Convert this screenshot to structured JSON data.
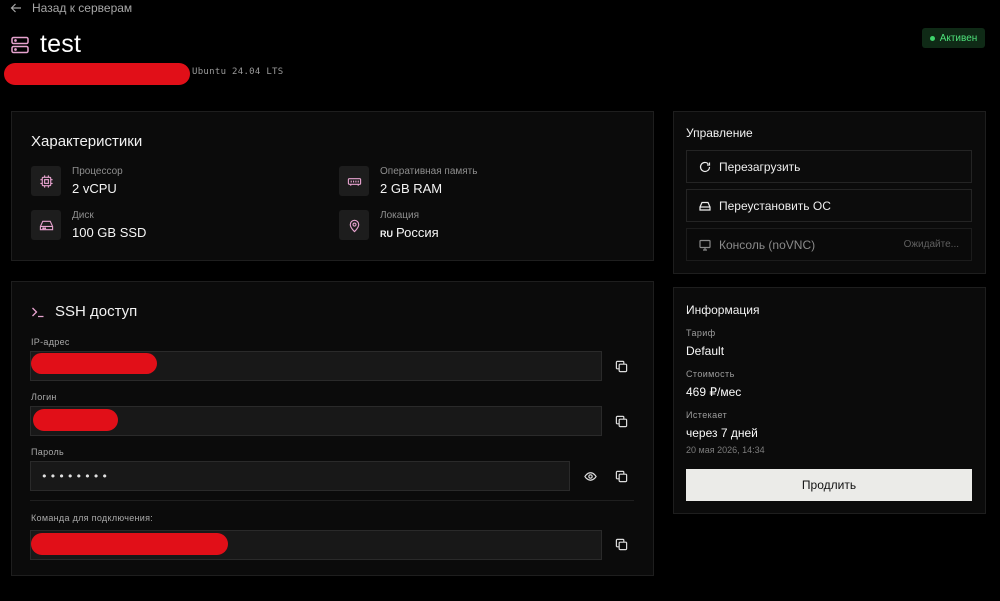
{
  "nav": {
    "back_label": "Назад к серверам"
  },
  "server": {
    "name": "test",
    "os": "Ubuntu 24.04 LTS",
    "status": "Активен"
  },
  "specs": {
    "title": "Характеристики",
    "items": [
      {
        "label": "Процессор",
        "value": "2 vCPU",
        "icon": "cpu-icon"
      },
      {
        "label": "Оперативная память",
        "value": "2 GB RAM",
        "icon": "memory-icon"
      },
      {
        "label": "Диск",
        "value": "100 GB SSD",
        "icon": "hard-drive-icon"
      },
      {
        "label": "Локация",
        "country_code": "RU",
        "value": "Россия",
        "icon": "map-pin-icon"
      }
    ]
  },
  "ssh": {
    "title": "SSH доступ",
    "ip_label": "IP-адрес",
    "login_label": "Логин",
    "password_label": "Пароль",
    "password_value": "••••••••",
    "command_label": "Команда для подключения:"
  },
  "manage": {
    "title": "Управление",
    "reboot_label": "Перезагрузить",
    "reinstall_label": "Переустановить ОС",
    "console_label": "Консоль (noVNC)",
    "console_status": "Ожидайте..."
  },
  "info": {
    "title": "Информация",
    "tariff_label": "Тариф",
    "tariff_value": "Default",
    "price_label": "Стоимость",
    "price_value": "469 ₽/мес",
    "expires_label": "Истекает",
    "expires_value": "через 7 дней",
    "expires_date": "20 мая 2026, 14:34",
    "renew_label": "Продлить"
  },
  "colors": {
    "background": "#000000",
    "card": "#0b0b0b",
    "accent_pink": "#e7a3cf",
    "status_green": "#4ee17a",
    "redaction": "#e10f18"
  }
}
